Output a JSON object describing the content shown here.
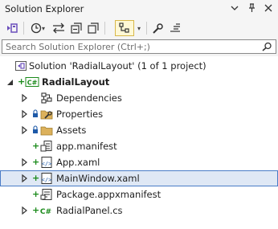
{
  "window": {
    "title": "Solution Explorer"
  },
  "search": {
    "placeholder": "Search Solution Explorer (Ctrl+;)"
  },
  "tree": {
    "solution": "Solution 'RadialLayout' (1 of 1 project)",
    "project": "RadialLayout",
    "items": [
      {
        "label": "Dependencies",
        "icon": "dependencies-icon"
      },
      {
        "label": "Properties",
        "icon": "properties-icon"
      },
      {
        "label": "Assets",
        "icon": "folder-icon"
      },
      {
        "label": "app.manifest",
        "icon": "manifest-icon"
      },
      {
        "label": "App.xaml",
        "icon": "xaml-icon"
      },
      {
        "label": "MainWindow.xaml",
        "icon": "xaml-icon"
      },
      {
        "label": "Package.appxmanifest",
        "icon": "appxmanifest-icon"
      },
      {
        "label": "RadialPanel.cs",
        "icon": "csharp-icon"
      }
    ]
  },
  "colors": {
    "accent": "#4a7cc7",
    "selection": "#dfe8f5",
    "plus": "#1a8a1a"
  }
}
